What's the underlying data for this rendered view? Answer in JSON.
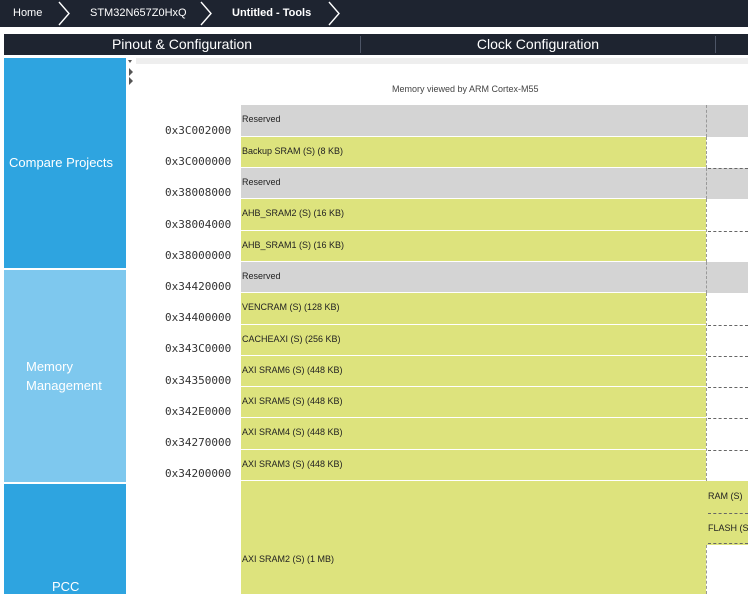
{
  "breadcrumb": {
    "items": [
      {
        "label": "Home"
      },
      {
        "label": "STM32N657Z0HxQ"
      },
      {
        "label": "Untitled - Tools"
      }
    ]
  },
  "tabs": [
    {
      "label": "Pinout & Configuration"
    },
    {
      "label": "Clock Configuration"
    }
  ],
  "sidebar": {
    "items": [
      {
        "label": "Compare Projects"
      },
      {
        "label_line1": "Memory",
        "label_line2": "Management"
      },
      {
        "label": "PCC"
      }
    ]
  },
  "memory_view": {
    "title": "Memory viewed by ARM Cortex-M55",
    "regions": [
      {
        "address": "0x3C002000",
        "label": "Reserved",
        "kind": "reserved"
      },
      {
        "address": "0x3C000000",
        "label": "Backup SRAM (S) (8 KB)",
        "kind": "sram"
      },
      {
        "address": "0x38008000",
        "label": "Reserved",
        "kind": "reserved"
      },
      {
        "address": "0x38004000",
        "label": "AHB_SRAM2 (S) (16 KB)",
        "kind": "sram"
      },
      {
        "address": "0x38000000",
        "label": "AHB_SRAM1 (S) (16 KB)",
        "kind": "sram"
      },
      {
        "address": "0x34420000",
        "label": "Reserved",
        "kind": "reserved"
      },
      {
        "address": "0x34400000",
        "label": "VENCRAM (S) (128 KB)",
        "kind": "sram"
      },
      {
        "address": "0x343C0000",
        "label": "CACHEAXI (S) (256 KB)",
        "kind": "sram"
      },
      {
        "address": "0x34350000",
        "label": "AXI SRAM6 (S) (448 KB)",
        "kind": "sram"
      },
      {
        "address": "0x342E0000",
        "label": "AXI SRAM5 (S) (448 KB)",
        "kind": "sram"
      },
      {
        "address": "0x34270000",
        "label": "AXI SRAM4 (S) (448 KB)",
        "kind": "sram"
      },
      {
        "address": "0x34200000",
        "label": "AXI SRAM3 (S) (448 KB)",
        "kind": "sram"
      },
      {
        "address": "",
        "label": "AXI SRAM2 (S) (1 MB)",
        "kind": "sram"
      }
    ],
    "right_column": {
      "labels": [
        "RAM (S)",
        "FLASH (S"
      ]
    }
  },
  "colors": {
    "nav_bg": "#1e2430",
    "sidebar_blue": "#2ea4e0",
    "sidebar_light_blue": "#7ec8ee",
    "sram_fill": "#dde37d",
    "reserved_fill": "#d4d4d4"
  }
}
